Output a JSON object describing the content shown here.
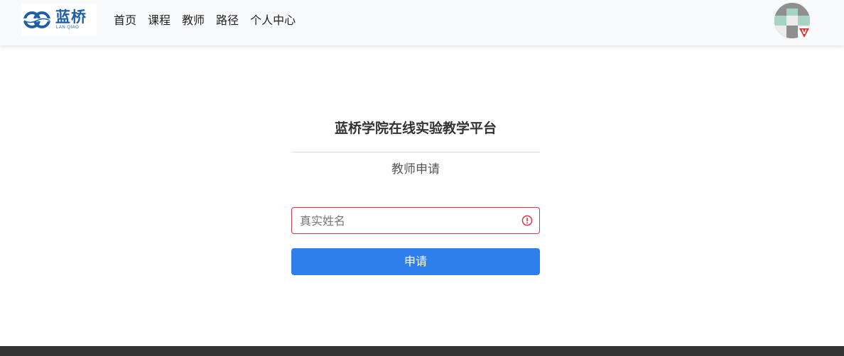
{
  "header": {
    "logo": {
      "cn": "蓝桥",
      "en": "LAN QIAO",
      "color": "#1e5fa8"
    },
    "nav": [
      "首页",
      "课程",
      "教师",
      "路径",
      "个人中心"
    ],
    "avatar": {
      "badge": "V",
      "badge_color": "#e03131"
    }
  },
  "main": {
    "site_title": "蓝桥学院在线实验教学平台",
    "subtitle": "教师申请",
    "name_field": {
      "placeholder": "真实姓名",
      "value": "",
      "state": "invalid"
    },
    "apply_label": "申请"
  },
  "colors": {
    "accent": "#2f7fea",
    "error": "#dc3545",
    "footer": "#343434"
  }
}
